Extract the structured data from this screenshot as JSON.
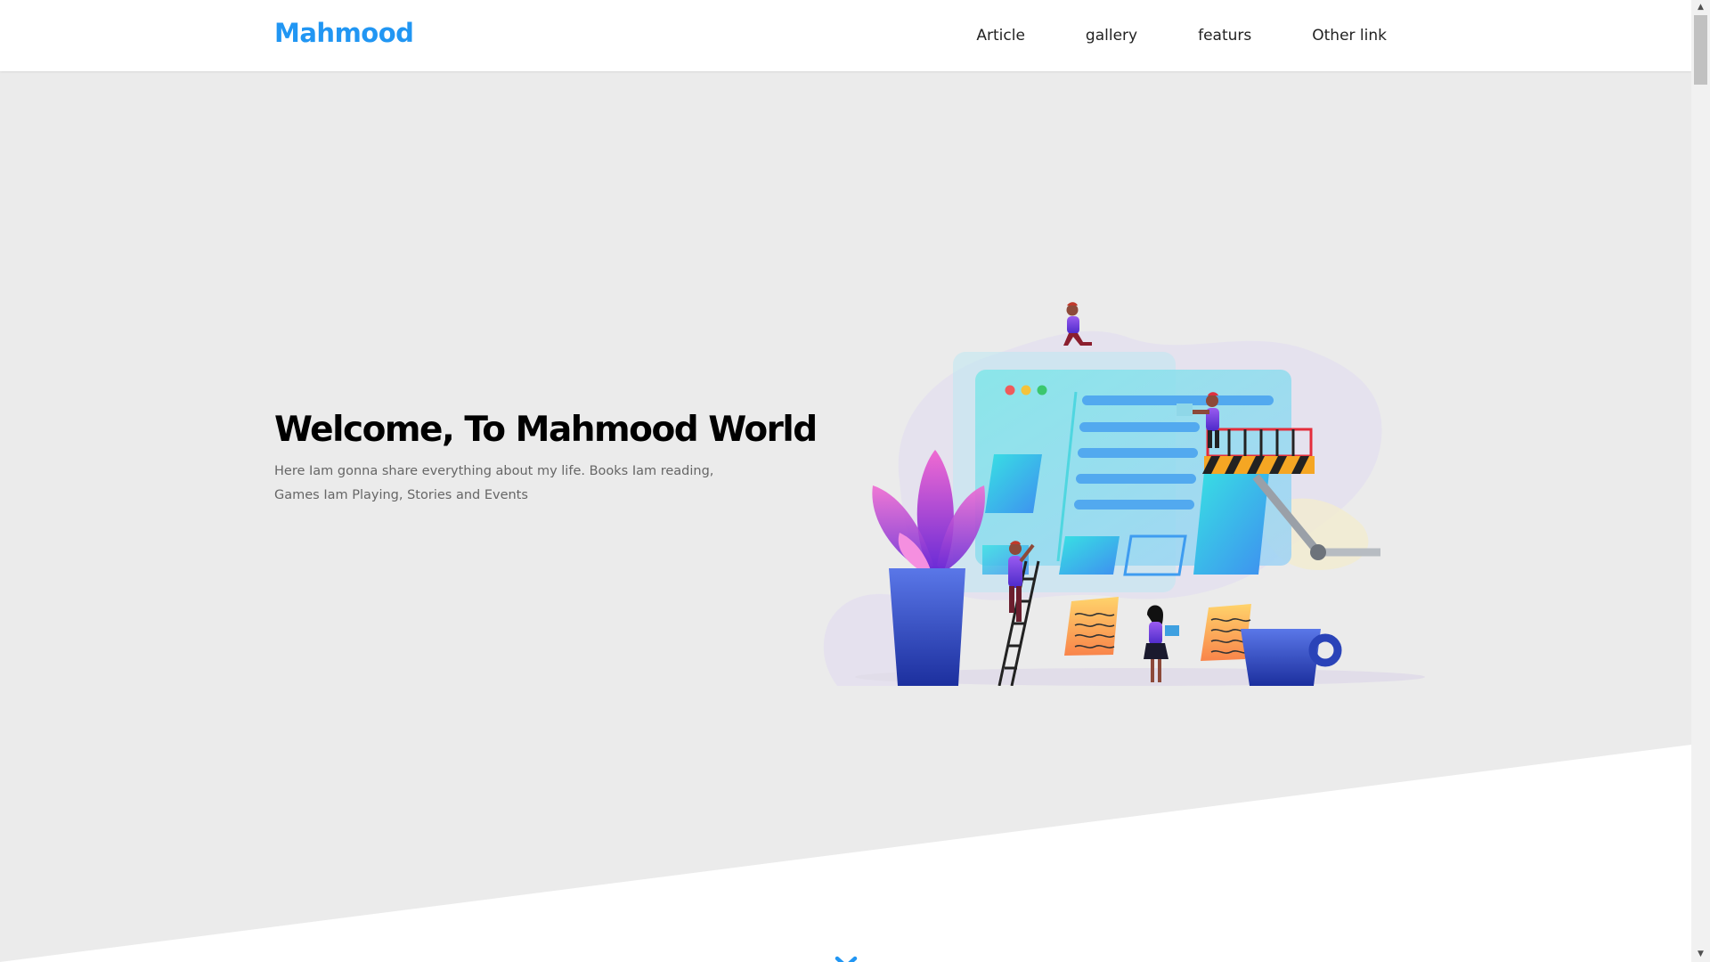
{
  "header": {
    "logo": "Mahmood",
    "nav": [
      {
        "label": "Article"
      },
      {
        "label": "gallery"
      },
      {
        "label": "featurs"
      },
      {
        "label": "Other link"
      }
    ]
  },
  "hero": {
    "title": "Welcome, To Mahmood World",
    "text": "Here Iam gonna share everything about my life. Books Iam reading, Games Iam Playing, Stories and Events",
    "illustration": "website-building-illustration",
    "scroll_icon": "double-chevron-down-icon"
  },
  "colors": {
    "accent": "#2196f3",
    "hero_background": "#ebebeb",
    "page_background": "#ffffff",
    "title": "#000000",
    "text": "#666666"
  },
  "scrollbar": {
    "up_icon": "scroll-up-arrow-icon",
    "down_icon": "scroll-down-arrow-icon"
  }
}
